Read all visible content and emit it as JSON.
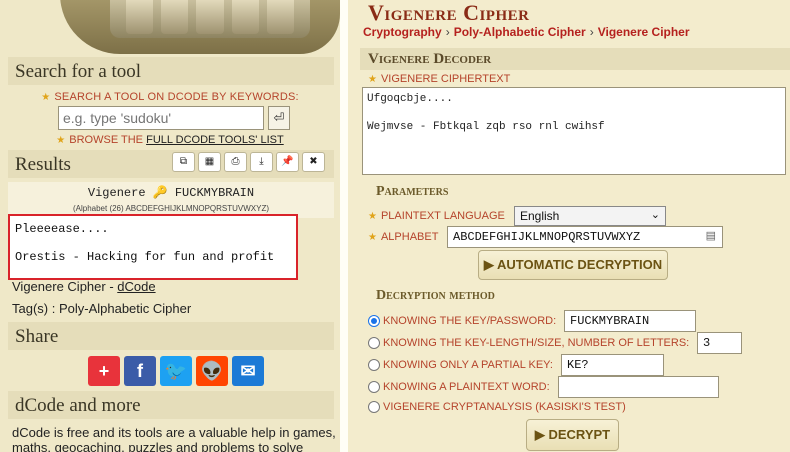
{
  "sidebar": {
    "search_section_title": "Search for a tool",
    "search_label": "Search a tool on dCode by keywords:",
    "search_placeholder": "e.g. type 'sudoku'",
    "search_button_glyph": "⏎",
    "browse_prefix": "Browse the",
    "browse_link": "full dCode tools' list",
    "results_title": "Results",
    "toolbar_glyphs": [
      "⧉",
      "▦",
      "⎙",
      "⤓",
      "📌",
      "✖"
    ],
    "result_header": "Vigenere 🔑 FUCKMYBRAIN",
    "result_alphabet_note": "(Alphabet (26) ABCDEFGHIJKLMNOPQRSTUVWXYZ)",
    "result_text": "Pleeeease....\n\nOrestis - Hacking for fun and profit",
    "result_source_prefix": "Vigenere Cipher - ",
    "result_source_link": "dCode",
    "tags_line": "Tag(s) : Poly-Alphabetic Cipher",
    "share_title": "Share",
    "share_icons": [
      {
        "name": "addthis-icon",
        "glyph": "+",
        "color": "#e8333b"
      },
      {
        "name": "facebook-icon",
        "glyph": "f",
        "color": "#3b5ca8"
      },
      {
        "name": "twitter-icon",
        "glyph": "🐦",
        "color": "#1da1f2"
      },
      {
        "name": "reddit-icon",
        "glyph": "👽",
        "color": "#ff4500"
      },
      {
        "name": "email-icon",
        "glyph": "✉",
        "color": "#1c7ad6"
      }
    ],
    "more_title": "dCode and more",
    "about_text": "dCode is free and its tools are a valuable help in games, maths, geocaching, puzzles and problems to solve"
  },
  "main": {
    "title": "Vigenere Cipher",
    "breadcrumbs": [
      "Cryptography",
      "Poly-Alphabetic Cipher",
      "Vigenere Cipher"
    ],
    "decoder_title": "Vigenere Decoder",
    "ciphertext_label": "Vigenere Ciphertext",
    "ciphertext_value": "Ufgoqcbje....\n\nWejmvse - Fbtkqal zqb rso rnl cwihsf",
    "parameters_title": "Parameters",
    "language_label": "Plaintext Language",
    "language_value": "English",
    "alphabet_label": "Alphabet",
    "alphabet_value": "ABCDEFGHIJKLMNOPQRSTUVWXYZ",
    "auto_button": "▶ Automatic Decryption",
    "method_title": "Decryption method",
    "methods": [
      {
        "label": "Knowing the key/password:",
        "value": "FUCKMYBRAIN",
        "selected": true
      },
      {
        "label": "Knowing the key-length/size, number of letters:",
        "value": "3",
        "selected": false
      },
      {
        "label": "Knowing only a partial key:",
        "value": "KE?",
        "selected": false
      },
      {
        "label": "Knowing a plaintext word:",
        "value": "",
        "selected": false
      },
      {
        "label": "Vigenere cryptanalysis (Kasiski's test)",
        "value": null,
        "selected": false
      }
    ],
    "decrypt_button": "▶ Decrypt"
  }
}
